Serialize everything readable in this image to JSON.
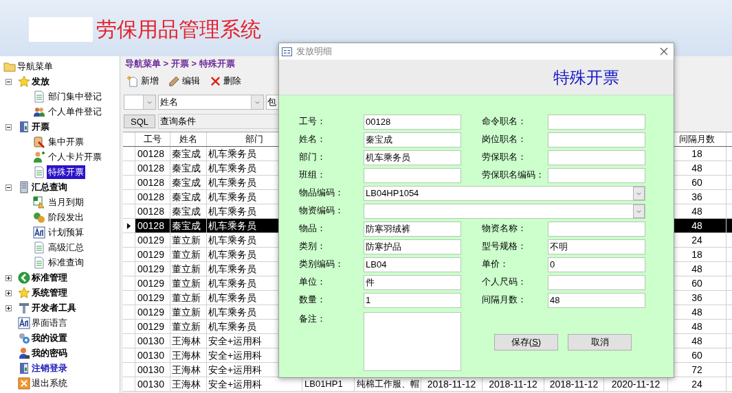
{
  "header": {
    "title": "劳保用品管理系统"
  },
  "sidebar": {
    "root": {
      "label": "导航菜单",
      "kind": "folder",
      "children": [
        {
          "label": "发放",
          "kind": "star",
          "bold": true,
          "link": false,
          "expanded": true,
          "children": [
            {
              "label": "部门集中登记",
              "kind": "document",
              "selected": false
            },
            {
              "label": "个人单件登记",
              "kind": "people",
              "selected": false
            }
          ]
        },
        {
          "label": "开票",
          "kind": "door",
          "bold": true,
          "link": false,
          "expanded": true,
          "children": [
            {
              "label": "集中开票",
              "kind": "stamp",
              "selected": false
            },
            {
              "label": "个人卡片开票",
              "kind": "person-add",
              "selected": false
            },
            {
              "label": "特殊开票",
              "kind": "document",
              "selected": true
            }
          ]
        },
        {
          "label": "汇总查询",
          "kind": "server",
          "bold": true,
          "link": false,
          "expanded": true,
          "children": [
            {
              "label": "当月到期",
              "kind": "spreadsheet",
              "selected": false
            },
            {
              "label": "阶段发出",
              "kind": "coins",
              "selected": false
            },
            {
              "label": "计划预算",
              "kind": "font",
              "selected": false
            },
            {
              "label": "高级汇总",
              "kind": "document",
              "selected": false
            },
            {
              "label": "标准查询",
              "kind": "document",
              "selected": false
            }
          ]
        },
        {
          "label": "标准管理",
          "kind": "back",
          "bold": true,
          "link": false,
          "expanded": false
        },
        {
          "label": "系统管理",
          "kind": "star",
          "bold": true,
          "link": false,
          "expanded": false
        },
        {
          "label": "开发者工具",
          "kind": "tools",
          "bold": true,
          "link": false,
          "expanded": false
        },
        {
          "label": "界面语言",
          "kind": "font",
          "bold": false,
          "link": false
        },
        {
          "label": "我的设置",
          "kind": "gears",
          "bold": true,
          "link": false
        },
        {
          "label": "我的密码",
          "kind": "user-key",
          "bold": true,
          "link": false
        },
        {
          "label": "注销登录",
          "kind": "door",
          "bold": true,
          "link": true
        },
        {
          "label": "退出系统",
          "kind": "exit",
          "bold": false,
          "link": false
        }
      ]
    }
  },
  "breadcrumb": "导航菜单 > 开票 > 特殊开票",
  "toolbar": [
    {
      "label": "新增",
      "kind": "new"
    },
    {
      "label": "编辑",
      "kind": "edit"
    },
    {
      "label": "删除",
      "kind": "delete"
    }
  ],
  "filter": {
    "field": "姓名",
    "operator": "包"
  },
  "query": {
    "button": "SQL",
    "value": "查询条件"
  },
  "table": {
    "columns": {
      "id": "工号",
      "name": "姓名",
      "dept": "部门",
      "interval": "间隔月数"
    },
    "rows": [
      {
        "id": "00128",
        "name": "秦宝成",
        "dept": "机车乘务员",
        "interval": "18",
        "selected": false
      },
      {
        "id": "00128",
        "name": "秦宝成",
        "dept": "机车乘务员",
        "interval": "48",
        "selected": false
      },
      {
        "id": "00128",
        "name": "秦宝成",
        "dept": "机车乘务员",
        "interval": "60",
        "selected": false
      },
      {
        "id": "00128",
        "name": "秦宝成",
        "dept": "机车乘务员",
        "interval": "36",
        "selected": false
      },
      {
        "id": "00128",
        "name": "秦宝成",
        "dept": "机车乘务员",
        "interval": "48",
        "selected": false
      },
      {
        "id": "00128",
        "name": "秦宝成",
        "dept": "机车乘务员",
        "interval": "48",
        "selected": true
      },
      {
        "id": "00129",
        "name": "董立新",
        "dept": "机车乘务员",
        "interval": "24",
        "selected": false
      },
      {
        "id": "00129",
        "name": "董立新",
        "dept": "机车乘务员",
        "interval": "18",
        "selected": false
      },
      {
        "id": "00129",
        "name": "董立新",
        "dept": "机车乘务员",
        "interval": "48",
        "selected": false
      },
      {
        "id": "00129",
        "name": "董立新",
        "dept": "机车乘务员",
        "interval": "60",
        "selected": false
      },
      {
        "id": "00129",
        "name": "董立新",
        "dept": "机车乘务员",
        "interval": "36",
        "selected": false
      },
      {
        "id": "00129",
        "name": "董立新",
        "dept": "机车乘务员",
        "interval": "48",
        "selected": false
      },
      {
        "id": "00129",
        "name": "董立新",
        "dept": "机车乘务员",
        "interval": "48",
        "selected": false
      },
      {
        "id": "00130",
        "name": "王海林",
        "dept": "安全+运用科",
        "interval": "48",
        "selected": false
      },
      {
        "id": "00130",
        "name": "王海林",
        "dept": "安全+运用科",
        "interval": "60",
        "selected": false
      },
      {
        "id": "00130",
        "name": "王海林",
        "dept": "安全+运用科",
        "interval": "72",
        "selected": false
      },
      {
        "id": "00130",
        "name": "王海林",
        "dept": "安全+运用科",
        "interval": "24",
        "selected": false,
        "hidden_cells": [
          "LB01HP1",
          "纯棉工作服、帽",
          "2018-11-12",
          "2018-11-12",
          "2018-11-12",
          "2020-11-12"
        ]
      }
    ]
  },
  "dialog": {
    "title": "发放明细",
    "heading": "特殊开票",
    "rows": [
      {
        "kind": "pair",
        "left": {
          "label": "工号：",
          "value": "00128"
        },
        "right": {
          "label": "命令职名："
        }
      },
      {
        "kind": "pair",
        "left": {
          "label": "姓名：",
          "value": "秦宝成"
        },
        "right": {
          "label": "岗位职名："
        }
      },
      {
        "kind": "pair",
        "left": {
          "label": "部门：",
          "value": "机车乘务员"
        },
        "right": {
          "label": "劳保职名："
        }
      },
      {
        "kind": "pair",
        "left": {
          "label": "班组："
        },
        "right": {
          "label": "劳保职名编码："
        }
      },
      {
        "kind": "combo",
        "label": "物品编码：",
        "value": "LB04HP1054"
      },
      {
        "kind": "combo",
        "label": "物资编码："
      },
      {
        "kind": "pair",
        "left": {
          "label": "物品：",
          "value": "防寒羽绒裤"
        },
        "right": {
          "label": "物资名称："
        }
      },
      {
        "kind": "pair",
        "left": {
          "label": "类别：",
          "value": "防寒护品"
        },
        "right": {
          "label": "型号规格：",
          "value": "不明"
        }
      },
      {
        "kind": "pair",
        "left": {
          "label": "类别编码：",
          "value": "LB04"
        },
        "right": {
          "label": "单价：",
          "value": "0"
        }
      },
      {
        "kind": "pair",
        "left": {
          "label": "单位：",
          "value": "件"
        },
        "right": {
          "label": "个人尺码："
        }
      },
      {
        "kind": "pair",
        "left": {
          "label": "数量：",
          "value": "1"
        },
        "right": {
          "label": "间隔月数：",
          "value": "48"
        }
      },
      {
        "kind": "memo",
        "label": "备注："
      }
    ],
    "buttons": [
      "保存(**S**)",
      "取消"
    ]
  }
}
